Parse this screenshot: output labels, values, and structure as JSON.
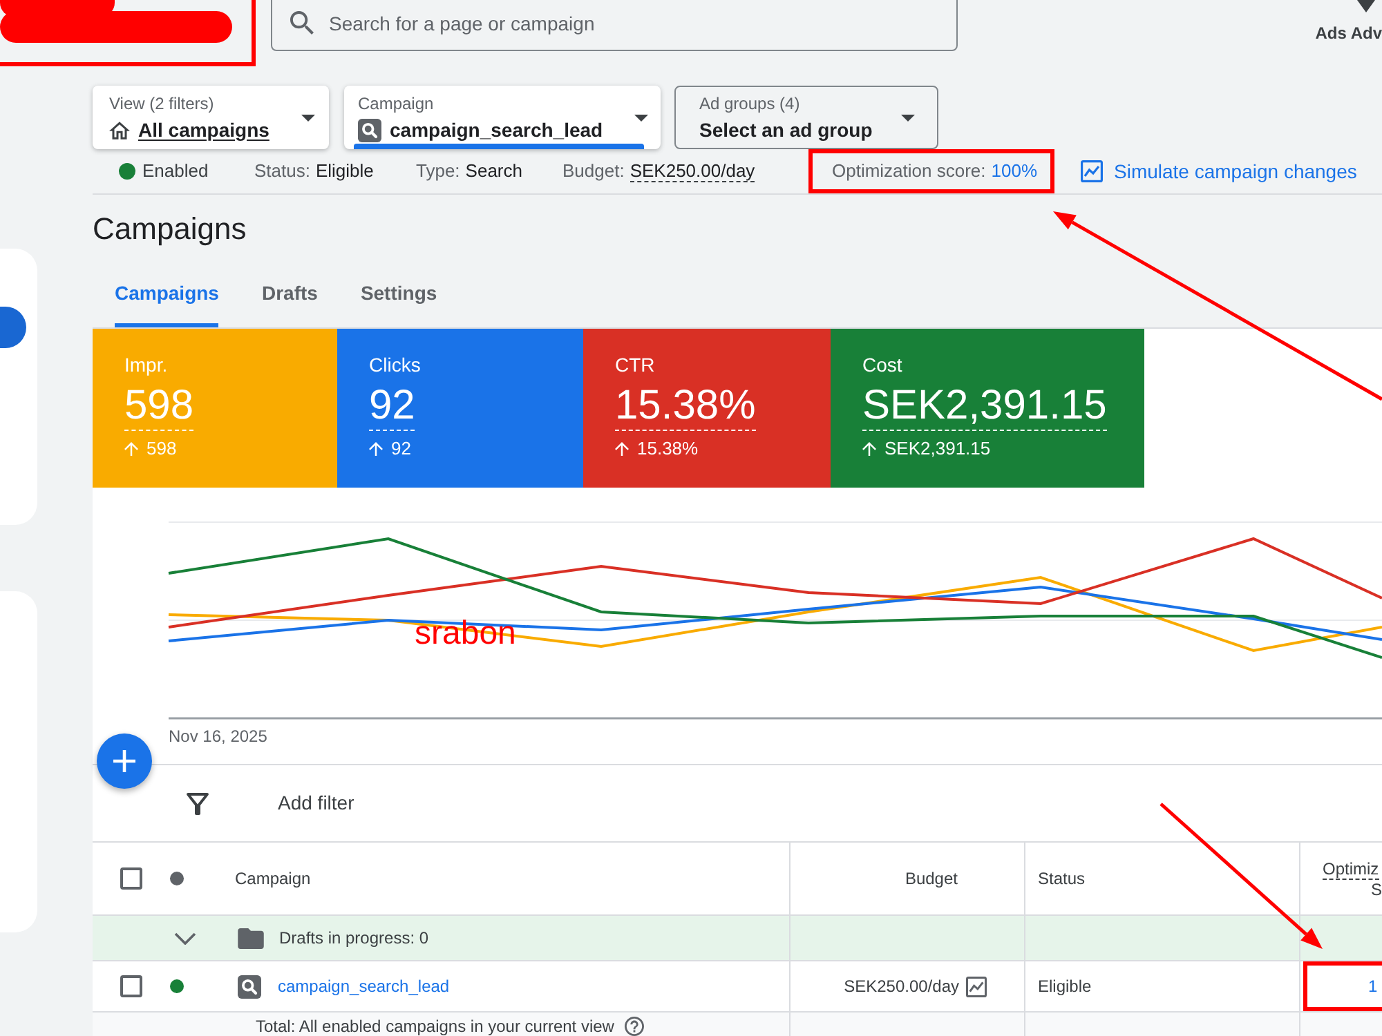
{
  "brand": {
    "redacted": true,
    "annotated": true
  },
  "header": {
    "search": {
      "placeholder": "Search for a page or campaign"
    },
    "advisor": {
      "label": "Ads Adv"
    }
  },
  "pickers": [
    {
      "kind": "view",
      "label": "View (2 filters)",
      "value": "All campaigns",
      "selected": false
    },
    {
      "kind": "campaign",
      "label": "Campaign",
      "value": "campaign_search_lead",
      "selected": true
    },
    {
      "kind": "ad_group",
      "label": "Ad groups (4)",
      "value": "Select an ad group",
      "selected": false
    }
  ],
  "status_bar": {
    "state": {
      "label": "Enabled",
      "color": "#188038"
    },
    "items": [
      {
        "kind": "plain",
        "label": "Status:",
        "value": "Eligible",
        "annotated": false
      },
      {
        "kind": "plain",
        "label": "Type:",
        "value": "Search",
        "annotated": false
      },
      {
        "kind": "dashed",
        "label": "Budget:",
        "value": "SEK250.00/day",
        "annotated": false
      },
      {
        "kind": "link",
        "label": "Optimization score:",
        "value": "100%",
        "annotated": true
      }
    ],
    "action": {
      "label": "Simulate campaign changes"
    }
  },
  "page_title": "Campaigns",
  "tabs": [
    {
      "label": "Campaigns",
      "selected": true
    },
    {
      "label": "Drafts",
      "selected": false
    },
    {
      "label": "Settings",
      "selected": false
    }
  ],
  "metrics": [
    {
      "label": "Impr.",
      "value": "598",
      "change": "598",
      "color": "#f9ab00"
    },
    {
      "label": "Clicks",
      "value": "92",
      "change": "92",
      "color": "#1a73e8"
    },
    {
      "label": "CTR",
      "value": "15.38%",
      "change": "15.38%",
      "color": "#d93025"
    },
    {
      "label": "Cost",
      "value": "SEK2,391.15",
      "change": "SEK2,391.15",
      "color": "#188038"
    }
  ],
  "chart": {
    "start_label": "Nov 16, 2025",
    "note": "srabon"
  },
  "filter": {
    "label": "Add filter"
  },
  "table": {
    "select_all": {
      "checked": false
    },
    "columns": [
      {
        "label": "Campaign"
      },
      {
        "label": "Budget"
      },
      {
        "label": "Status"
      },
      {
        "label": "Optimiz",
        "label_line_2": "S"
      }
    ],
    "rows": [
      {
        "kind": "drafts",
        "label": "Drafts in progress: 0"
      },
      {
        "kind": "campaign",
        "checked": false,
        "color": "#188038",
        "name": "campaign_search_lead",
        "budget": "SEK250.00/day",
        "status": "Eligible",
        "optimization_score": "1",
        "annotated": true
      }
    ],
    "total": {
      "label": "Total: All enabled campaigns in your current view"
    }
  }
}
